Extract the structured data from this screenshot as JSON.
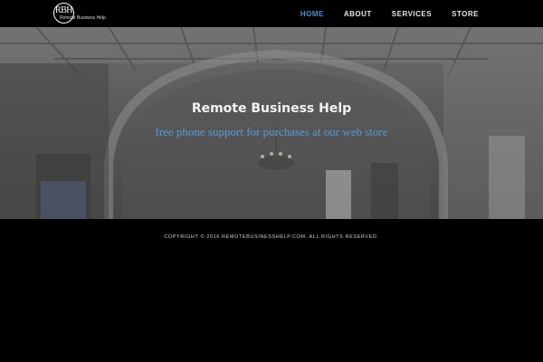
{
  "brand": {
    "logo_mark": "RBH",
    "logo_text": "Remote Business Help"
  },
  "nav": {
    "items": [
      {
        "label": "HOME",
        "active": true
      },
      {
        "label": "ABOUT",
        "active": false
      },
      {
        "label": "SERVICES",
        "active": false
      },
      {
        "label": "STORE",
        "active": false
      }
    ]
  },
  "hero": {
    "title": "Remote Business Help",
    "tagline": "free phone support for purchases at our web store"
  },
  "footer": {
    "copyright": "COPYRIGHT © 2016 REMOTEBUSINESSHELP.COM. ALL RIGHTS RESERVED."
  },
  "colors": {
    "accent": "#4a90d9",
    "tagline": "#4e9bd8",
    "background": "#000000"
  }
}
